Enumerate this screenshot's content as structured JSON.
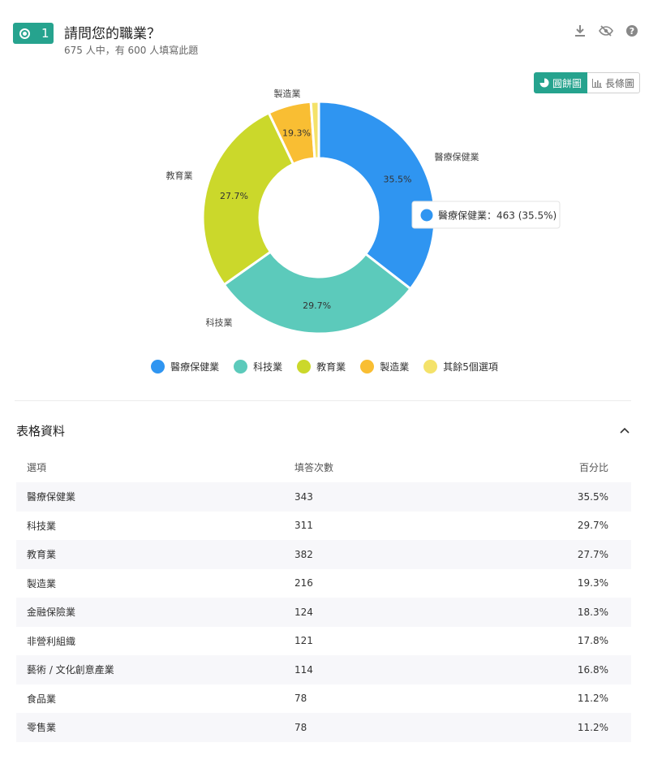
{
  "question": {
    "number": "1",
    "title": "請問您的職業？",
    "subtitle": "675 人中，有 600 人填寫此題"
  },
  "toolbar": {
    "icons": [
      "download-icon",
      "eye-off-icon",
      "help-icon"
    ]
  },
  "view_toggle": {
    "pie_label": "圓餅圖",
    "bar_label": "長條圖"
  },
  "tooltip": {
    "text": "醫療保健業：463 (35.5%)",
    "color": "#2f95f1"
  },
  "chart_data": {
    "type": "pie",
    "donut": true,
    "slices": [
      {
        "name": "醫療保健業",
        "percent": 35.5,
        "label": "35.5%",
        "color": "#2f95f1"
      },
      {
        "name": "科技業",
        "percent": 29.7,
        "label": "29.7%",
        "color": "#5ccabb"
      },
      {
        "name": "教育業",
        "percent": 27.7,
        "label": "27.7%",
        "color": "#cbd82b"
      },
      {
        "name": "製造業",
        "percent": 6.0,
        "label": "19.3%",
        "color": "#f9be33"
      },
      {
        "name": "其餘5個選項",
        "percent": 1.1,
        "label": "",
        "color": "#f4e26a"
      }
    ],
    "outer_labels": [
      "醫療保健業",
      "科技業",
      "教育業",
      "製造業"
    ],
    "legend": [
      "醫療保健業",
      "科技業",
      "教育業",
      "製造業",
      "其餘5個選項"
    ],
    "legend_placement": "bottom"
  },
  "table": {
    "title": "表格資料",
    "columns": [
      "選項",
      "填答次數",
      "百分比"
    ],
    "rows": [
      [
        "醫療保健業",
        "343",
        "35.5%"
      ],
      [
        "科技業",
        "311",
        "29.7%"
      ],
      [
        "教育業",
        "382",
        "27.7%"
      ],
      [
        "製造業",
        "216",
        "19.3%"
      ],
      [
        "金融保險業",
        "124",
        "18.3%"
      ],
      [
        "非營利組織",
        "121",
        "17.8%"
      ],
      [
        "藝術 / 文化創意產業",
        "114",
        "16.8%"
      ],
      [
        "食品業",
        "78",
        "11.2%"
      ],
      [
        "零售業",
        "78",
        "11.2%"
      ]
    ]
  }
}
